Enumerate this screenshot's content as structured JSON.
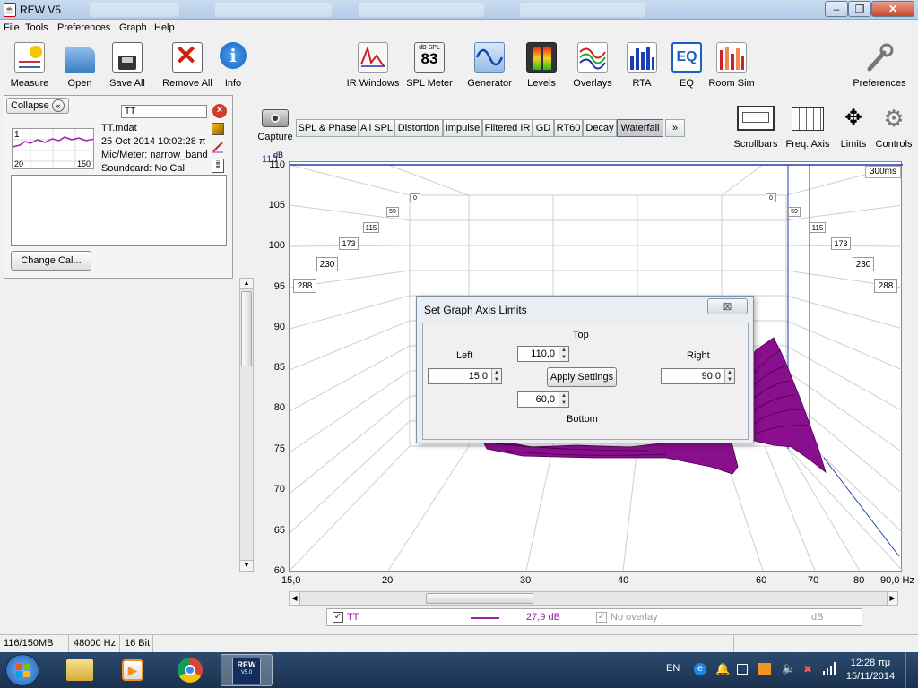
{
  "window": {
    "title": "REW V5"
  },
  "menu": [
    "File",
    "Tools",
    "Preferences",
    "Graph",
    "Help"
  ],
  "toolbar": {
    "left": [
      {
        "label": "Measure",
        "icon": "measure-icon"
      },
      {
        "label": "Open",
        "icon": "folder-icon"
      },
      {
        "label": "Save All",
        "icon": "save-all-icon"
      },
      {
        "label": "Remove All",
        "icon": "remove-all-icon"
      },
      {
        "label": "Info",
        "icon": "info-icon"
      }
    ],
    "tools": [
      {
        "label": "IR Windows",
        "icon": "ir-windows-icon"
      },
      {
        "label": "SPL Meter",
        "icon": "spl-meter-icon",
        "badge_top": "dB SPL",
        "badge_value": "83"
      },
      {
        "label": "Generator",
        "icon": "generator-icon"
      },
      {
        "label": "Levels",
        "icon": "levels-icon"
      },
      {
        "label": "Overlays",
        "icon": "overlays-icon"
      },
      {
        "label": "RTA",
        "icon": "rta-icon"
      },
      {
        "label": "EQ",
        "icon": "eq-icon",
        "badge_value": "EQ"
      },
      {
        "label": "Room Sim",
        "icon": "room-sim-icon"
      }
    ],
    "preferences": "Preferences"
  },
  "left_panel": {
    "collapse": "Collapse",
    "search_value": "TT",
    "thumb_number": "1",
    "thumb_x_min": "20",
    "thumb_x_max": "150",
    "measurement": {
      "name": "TT.mdat",
      "date": "25 Oct 2014 10:02:28 π",
      "mic": "Mic/Meter: narrow_band",
      "soundcard": "Soundcard: No Cal"
    },
    "change_cal": "Change Cal..."
  },
  "graph_tabs": {
    "capture": "Capture",
    "tabs": [
      "SPL & Phase",
      "All SPL",
      "Distortion",
      "Impulse",
      "Filtered IR",
      "GD",
      "RT60",
      "Decay",
      "Waterfall",
      "»"
    ],
    "active": "Waterfall",
    "right_buttons": [
      "Scrollbars",
      "Freq. Axis",
      "Limits",
      "Controls"
    ]
  },
  "graph": {
    "y_unit": "dB",
    "y_top_label": "110",
    "y_ticks": [
      "110",
      "105",
      "100",
      "95",
      "90",
      "85",
      "80",
      "75",
      "70",
      "65",
      "60"
    ],
    "x_ticks": [
      "15,0",
      "20",
      "30",
      "40",
      "60",
      "70",
      "80",
      "90,0 Hz"
    ],
    "time_tag": "300ms",
    "time_slices": [
      "0",
      "59",
      "115",
      "173",
      "230",
      "288"
    ]
  },
  "dialog": {
    "title": "Set Graph Axis Limits",
    "top_label": "Top",
    "top_value": "110,0",
    "left_label": "Left",
    "left_value": "15,0",
    "right_label": "Right",
    "right_value": "90,0",
    "bottom_label": "Bottom",
    "bottom_value": "60,0",
    "apply": "Apply Settings"
  },
  "legend": {
    "name": "TT",
    "value": "27,9 dB",
    "overlay": "No overlay",
    "overlay_unit": "dB",
    "trace_color": "#9b1fa7"
  },
  "status": {
    "memory": "116/150MB",
    "rate": "48000 Hz",
    "bits": "16 Bit"
  },
  "taskbar": {
    "lang": "EN",
    "time": "12:28 πμ",
    "date": "15/11/2014",
    "rew_label": "REW",
    "rew_version": "V5.0"
  },
  "colors": {
    "waterfall": "#8a0f8f",
    "axis_line": "#1a3fb0",
    "accent": "#9b1fa7"
  }
}
